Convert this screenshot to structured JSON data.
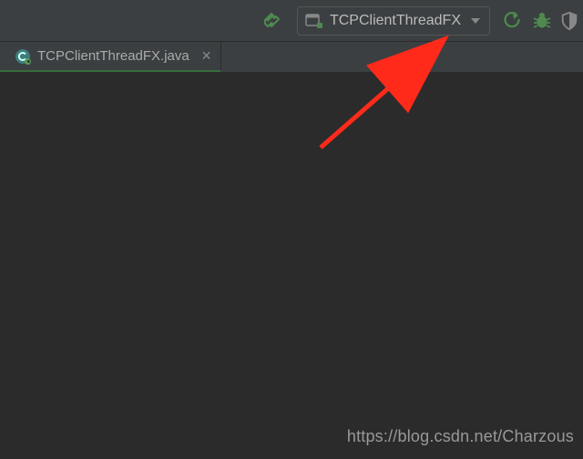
{
  "toolbar": {
    "run_config_label": "TCPClientThreadFX"
  },
  "tabs": [
    {
      "filename": "TCPClientThreadFX.java",
      "active": true
    }
  ],
  "watermark": "https://blog.csdn.net/Charzous",
  "icons": {
    "hammer": "hammer-icon",
    "application": "application-icon",
    "rerun": "rerun-icon",
    "bug": "bug-icon",
    "shield": "shield-icon",
    "java_class": "java-class-icon",
    "close": "close-icon",
    "dropdown": "chevron-down-icon"
  }
}
